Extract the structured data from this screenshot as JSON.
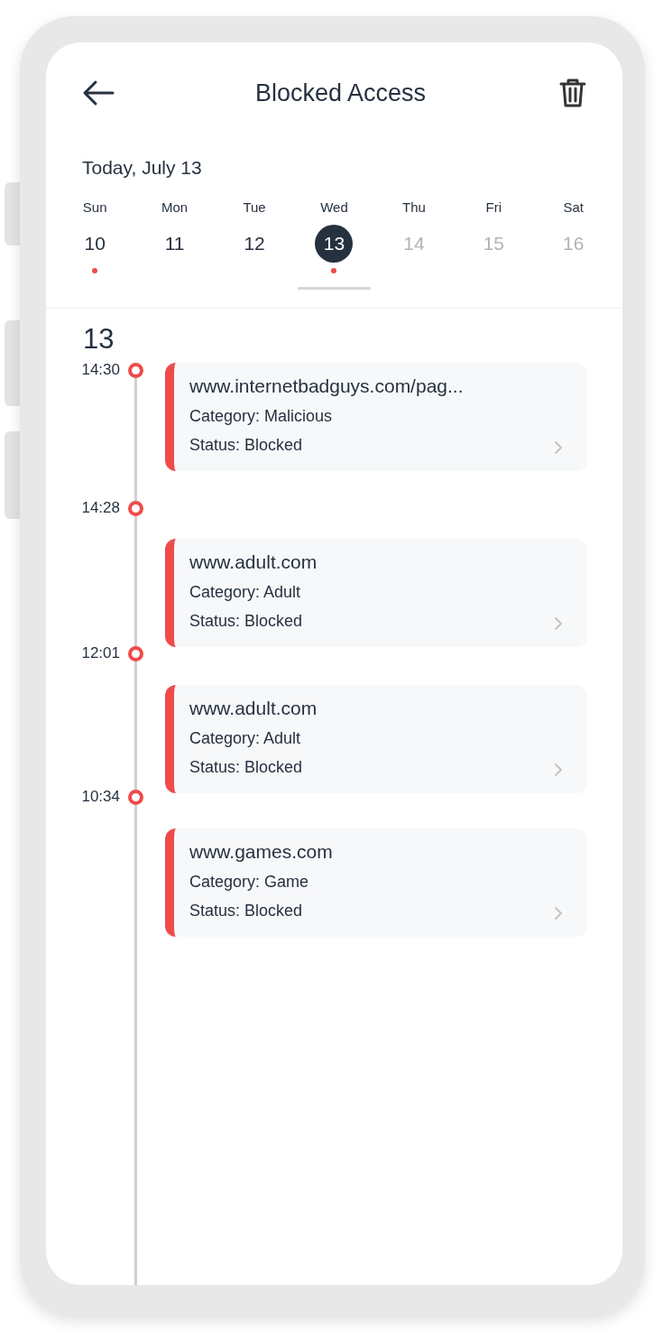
{
  "header": {
    "title": "Blocked Access"
  },
  "date_label": "Today, July 13",
  "days": [
    {
      "weekday": "Sun",
      "date": "10",
      "selected": false,
      "future": false,
      "alert": true
    },
    {
      "weekday": "Mon",
      "date": "11",
      "selected": false,
      "future": false,
      "alert": false
    },
    {
      "weekday": "Tue",
      "date": "12",
      "selected": false,
      "future": false,
      "alert": false
    },
    {
      "weekday": "Wed",
      "date": "13",
      "selected": true,
      "future": false,
      "alert": true
    },
    {
      "weekday": "Thu",
      "date": "14",
      "selected": false,
      "future": true,
      "alert": false
    },
    {
      "weekday": "Fri",
      "date": "15",
      "selected": false,
      "future": true,
      "alert": false
    },
    {
      "weekday": "Sat",
      "date": "16",
      "selected": false,
      "future": true,
      "alert": false
    }
  ],
  "section_day": "13",
  "times": [
    "14:30",
    "14:28",
    "12:01",
    "10:34"
  ],
  "entries": [
    {
      "url": "www.internetbadguys.com/pag...",
      "category": "Category: Malicious",
      "status": "Status: Blocked"
    },
    {
      "url": "www.adult.com",
      "category": "Category: Adult",
      "status": "Status: Blocked"
    },
    {
      "url": "www.adult.com",
      "category": "Category: Adult",
      "status": "Status: Blocked"
    },
    {
      "url": "www.games.com",
      "category": "Category: Game",
      "status": "Status: Blocked"
    }
  ]
}
